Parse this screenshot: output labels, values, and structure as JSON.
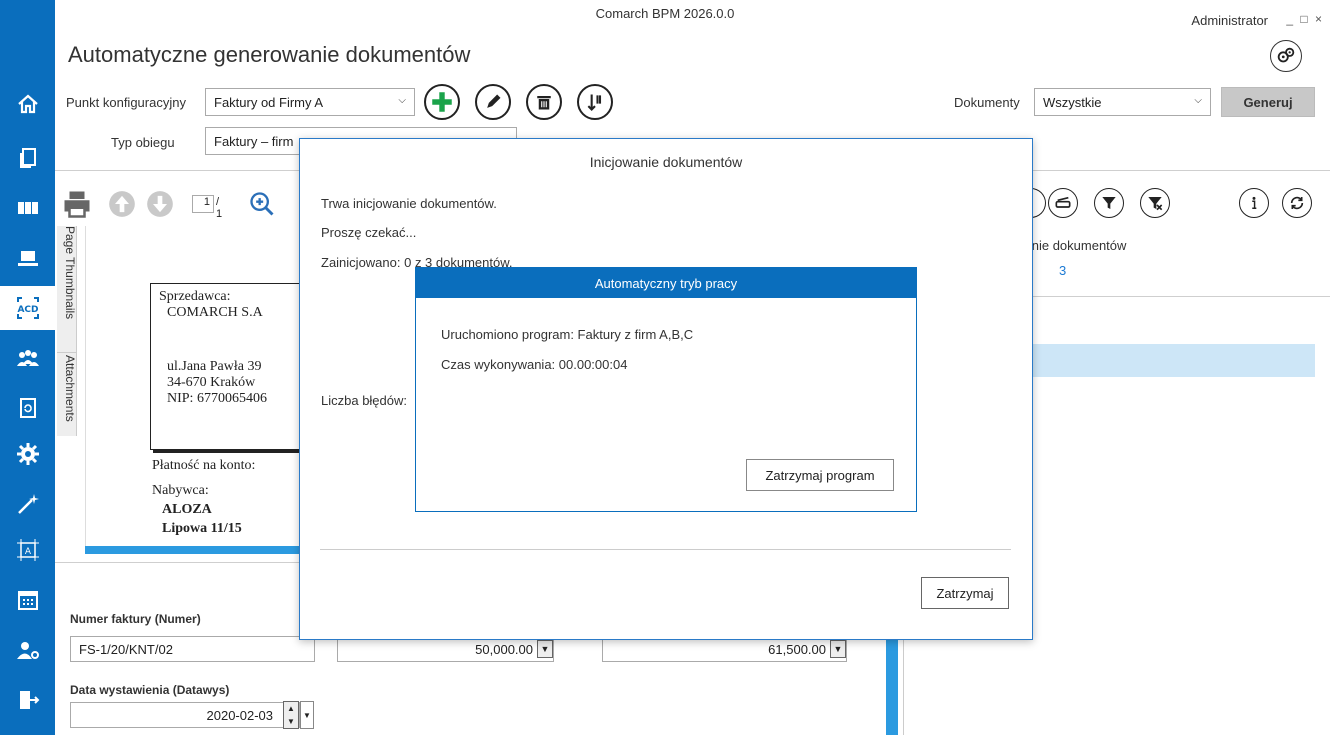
{
  "window": {
    "app_title": "Comarch BPM 2026.0.0",
    "user": "Administrator",
    "controls": "_ □ ×"
  },
  "page": {
    "title": "Automatyczne generowanie dokumentów"
  },
  "config": {
    "point_label": "Punkt konfiguracyjny",
    "point_value": "Faktury od Firmy A",
    "flow_label": "Typ obiegu",
    "flow_value": "Faktury – firm",
    "documents_label": "Dokumenty",
    "documents_value": "Wszystkie",
    "generate_label": "Generuj"
  },
  "viewer": {
    "page_current": "1",
    "page_total": "/ 1",
    "tabs": [
      "Page Thumbnails",
      "Attachments"
    ]
  },
  "document": {
    "seller_heading": "Sprzedawca:",
    "seller_name": "COMARCH S.A",
    "seller_street": "ul.Jana Pawła 39",
    "seller_city": "34-670 Kraków",
    "seller_nip": "NIP: 6770065406",
    "payment": "Płatność na konto:",
    "buyer_heading": "Nabywca:",
    "buyer_name": "ALOZA",
    "buyer_street": "Lipowa 11/15"
  },
  "form": {
    "invoice_number_label": "Numer faktury (Numer)",
    "invoice_number_value": "FS-1/20/KNT/02",
    "amount_net": "50,000.00",
    "amount_gross": "61,500.00",
    "issue_date_label": "Data wystawienia (Datawys)",
    "issue_date_value": "2020-02-03"
  },
  "right_panel": {
    "heading_fragment": "vanie dokumentów",
    "count": "3"
  },
  "dialog_init": {
    "title": "Inicjowanie dokumentów",
    "line1": "Trwa inicjowanie dokumentów.",
    "line2": "Proszę czekać...",
    "progress": "Zainicjowano: 0 z 3 dokumentów.",
    "errors": "Liczba błędów:",
    "stop_label": "Zatrzymaj"
  },
  "dialog_auto": {
    "title": "Automatyczny tryb pracy",
    "program": "Uruchomiono program: Faktury z firm A,B,C",
    "runtime": "Czas wykonywania:  00.00:00:04",
    "stop_label": "Zatrzymaj program"
  },
  "colors": {
    "accent": "#0a6ebd",
    "highlight": "#cde6f7",
    "add_green": "#1aa34a"
  }
}
